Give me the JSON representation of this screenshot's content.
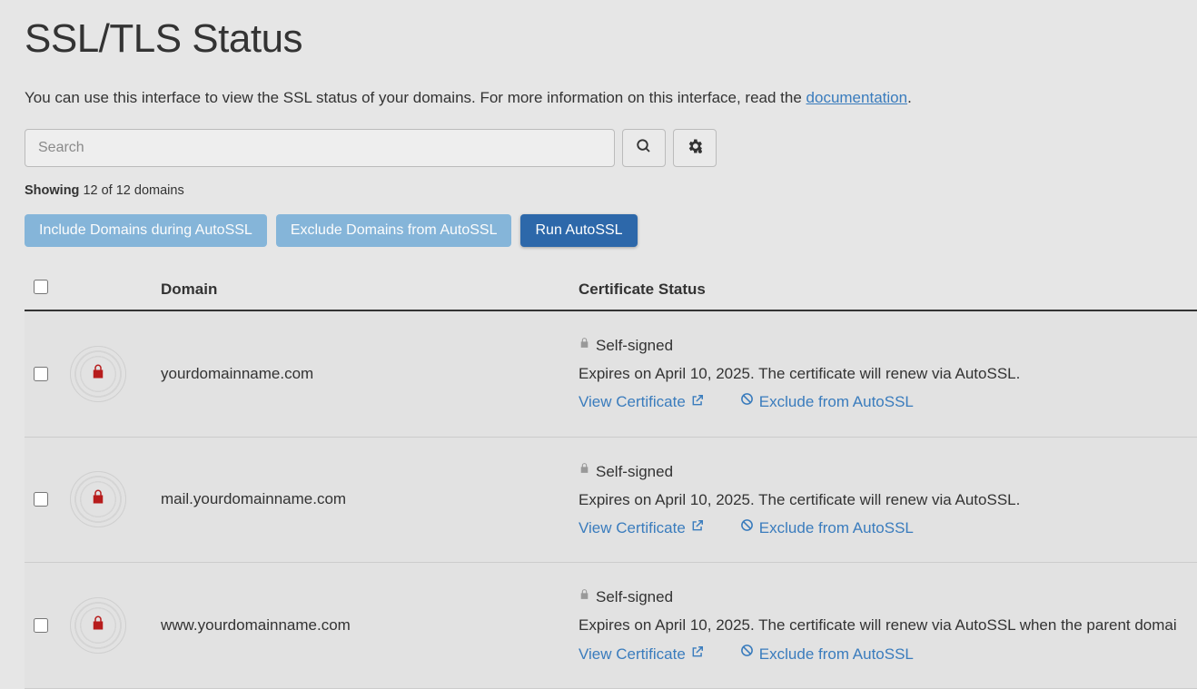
{
  "page": {
    "title": "SSL/TLS Status",
    "description_prefix": "You can use this interface to view the SSL status of your domains. For more information on this interface, read the ",
    "documentation_link_text": "documentation",
    "description_suffix": "."
  },
  "search": {
    "placeholder": "Search"
  },
  "showing": {
    "label": "Showing",
    "count_text": "12 of 12 domains"
  },
  "buttons": {
    "include": "Include Domains during AutoSSL",
    "exclude": "Exclude Domains from AutoSSL",
    "run": "Run AutoSSL"
  },
  "table": {
    "headers": {
      "domain": "Domain",
      "status": "Certificate Status"
    },
    "rows": [
      {
        "domain": "yourdomainname.com",
        "status_type": "Self-signed",
        "expires_text": "Expires on April 10, 2025. The certificate will renew via AutoSSL.",
        "view_text": "View Certificate",
        "exclude_text": "Exclude from AutoSSL"
      },
      {
        "domain": "mail.yourdomainname.com",
        "status_type": "Self-signed",
        "expires_text": "Expires on April 10, 2025. The certificate will renew via AutoSSL.",
        "view_text": "View Certificate",
        "exclude_text": "Exclude from AutoSSL"
      },
      {
        "domain": "www.yourdomainname.com",
        "status_type": "Self-signed",
        "expires_text": "Expires on April 10, 2025. The certificate will renew via AutoSSL when the parent domai",
        "view_text": "View Certificate",
        "exclude_text": "Exclude from AutoSSL"
      }
    ]
  }
}
